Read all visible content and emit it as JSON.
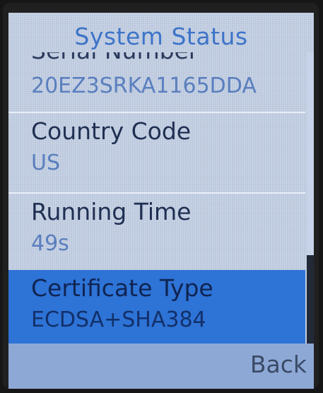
{
  "screen": {
    "title": "System Status"
  },
  "list": {
    "items": [
      {
        "label": "Serial Number",
        "value": "20EZ3SRKA1165DDA",
        "selected": false
      },
      {
        "label": "Country Code",
        "value": "US",
        "selected": false
      },
      {
        "label": "Running Time",
        "value": "49s",
        "selected": false
      },
      {
        "label": "Certificate Type",
        "value": "ECDSA+SHA384",
        "selected": true
      }
    ]
  },
  "softkeys": {
    "right_label": "Back"
  },
  "colors": {
    "title": "#3d74c8",
    "selection": "#2e73d6",
    "softkey_bar": "#8ea8d6"
  }
}
